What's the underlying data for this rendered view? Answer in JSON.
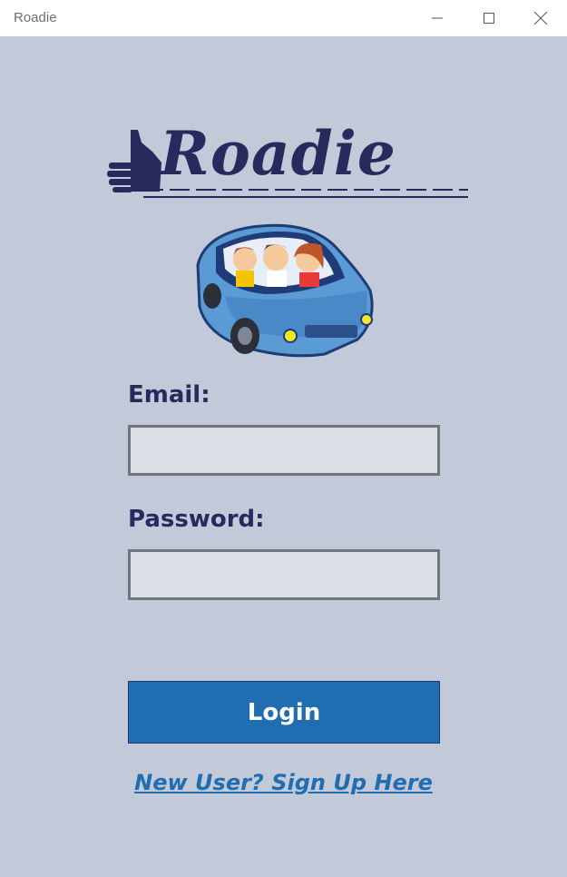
{
  "window": {
    "title": "Roadie",
    "controls": [
      "minimize-icon",
      "maximize-icon",
      "close-icon"
    ]
  },
  "logo": {
    "text": "Roadie",
    "icon": "thumbs-up-icon",
    "color": "#282a5e"
  },
  "illustration": {
    "icon": "car-with-family-icon",
    "colors": {
      "car": "#5b9bd5",
      "car_dark": "#1f3b78"
    }
  },
  "form": {
    "email_label": "Email:",
    "email_value": "",
    "password_label": "Password:",
    "password_value": "",
    "login_label": "Login",
    "signup_link": "New User? Sign Up Here"
  },
  "colors": {
    "background": "#c2c9d8",
    "label": "#262a5e",
    "field_bg": "#dadee7",
    "field_border": "#72767c",
    "button": "#216db2",
    "link": "#216db2"
  }
}
